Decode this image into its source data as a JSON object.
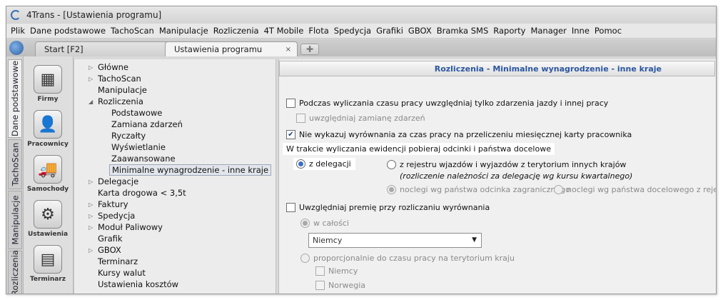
{
  "window": {
    "title": "4Trans - [Ustawienia programu]"
  },
  "menu": [
    "Plik",
    "Dane podstawowe",
    "TachoScan",
    "Manipulacje",
    "Rozliczenia",
    "4T Mobile",
    "Flota",
    "Spedycja",
    "Grafiki",
    "GBOX",
    "Bramka SMS",
    "Raporty",
    "Manager",
    "Inne",
    "Pomoc"
  ],
  "tabs": [
    {
      "label": "Start [F2]"
    },
    {
      "label": "Ustawienia programu",
      "close": "×"
    }
  ],
  "vertical_tabs": [
    "Dane podstawowe",
    "TachoScan",
    "Manipulacje",
    "Rozliczenia"
  ],
  "nav_items": [
    "Firmy",
    "Pracownicy",
    "Samochody",
    "Ustawienia",
    "Terminarz"
  ],
  "tree": [
    {
      "label": "Główne",
      "arrow": "▷"
    },
    {
      "label": "TachoScan",
      "arrow": "▷"
    },
    {
      "label": "Manipulacje",
      "arrow": ""
    },
    {
      "label": "Rozliczenia",
      "arrow": "◢"
    },
    {
      "label": "Podstawowe",
      "arrow": ""
    },
    {
      "label": "Zamiana zdarzeń",
      "arrow": ""
    },
    {
      "label": "Ryczałty",
      "arrow": ""
    },
    {
      "label": "Wyświetlanie",
      "arrow": ""
    },
    {
      "label": "Zaawansowane",
      "arrow": ""
    },
    {
      "label": "Minimalne wynagrodzenie - inne kraje",
      "arrow": ""
    },
    {
      "label": "Delegacje",
      "arrow": "▷"
    },
    {
      "label": "Karta drogowa < 3,5t",
      "arrow": ""
    },
    {
      "label": "Faktury",
      "arrow": "▷"
    },
    {
      "label": "Spedycja",
      "arrow": "▷"
    },
    {
      "label": "Moduł Paliwowy",
      "arrow": "▷"
    },
    {
      "label": "Grafik",
      "arrow": ""
    },
    {
      "label": "GBOX",
      "arrow": "▷"
    },
    {
      "label": "Terminarz",
      "arrow": ""
    },
    {
      "label": "Kursy walut",
      "arrow": ""
    },
    {
      "label": "Ustawienia kosztów",
      "arrow": ""
    }
  ],
  "panel": {
    "header": "Rozliczenia - Minimalne wynagrodzenie - inne kraje",
    "opt_work_time": "Podczas wyliczania czasu pracy uwzględniaj tylko zdarzenia jazdy i innej pracy",
    "opt_event_swap": "uwzględniaj zamianę zdarzeń",
    "opt_no_settlement": "Nie wykazuj wyrównania za czas pracy na przeliczeniu miesięcznej karty pracownika",
    "source_label": "W trakcie wyliczania ewidencji pobieraj odcinki i państwa docelowe",
    "radio_delegation": "z delegacji",
    "radio_register": "z rejestru wjazdów i wyjazdów z terytorium innych krajów",
    "register_note": "(rozliczenie należności za delegację wg kursu kwartalnego)",
    "radio_nights_segment": "noclegi wg państwa odcinka zagranicznego",
    "radio_nights_register": "noclegi wg państwa docelowego z rejestru",
    "opt_bonus": "Uwzględniaj premię przy rozliczaniu wyrównania",
    "radio_whole": "w całości",
    "combo_value": "Niemcy",
    "radio_proportional": "proporcjonalnie do czasu pracy na terytorium kraju",
    "country_1": "Niemcy",
    "country_2": "Norwegia"
  }
}
